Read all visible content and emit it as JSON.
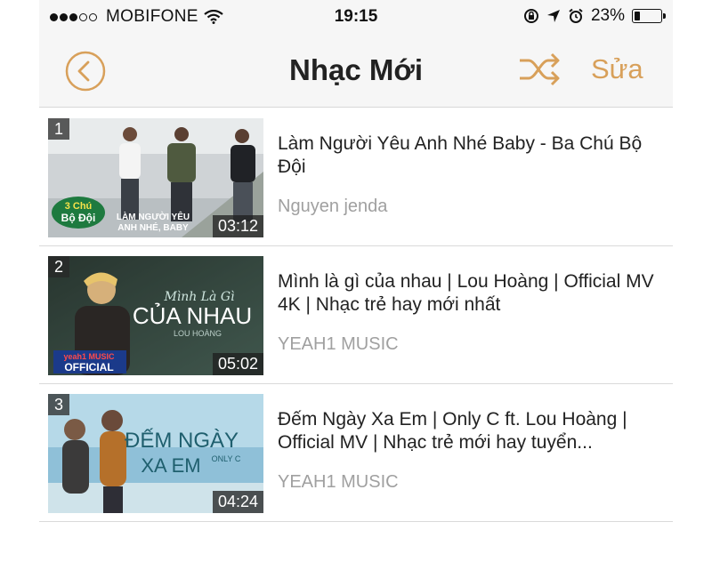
{
  "status_bar": {
    "carrier": "MOBIFONE",
    "time": "19:15",
    "battery_text": "23%",
    "battery_level": 0.23
  },
  "nav": {
    "title": "Nhạc Mới",
    "edit_label": "Sửa",
    "icon_names": [
      "back-circle-icon",
      "shuffle-icon"
    ],
    "accent_color": "#d8a05a"
  },
  "songs": [
    {
      "rank": "1",
      "title": "Làm Người Yêu Anh Nhé Baby - Ba Chú Bộ Đội",
      "channel": "Nguyen jenda",
      "duration": "03:12",
      "thumb_text_1": "3 Chú",
      "thumb_text_2": "Bộ Đội",
      "thumb_text_3": "LÀM NGƯỜI YÊU",
      "thumb_text_4": "ANH NHÉ, BABY"
    },
    {
      "rank": "2",
      "title": "Mình là gì của nhau | Lou Hoàng | Official MV 4K | Nhạc trẻ hay mới nhất",
      "channel": "YEAH1 MUSIC",
      "duration": "05:02",
      "thumb_text_1": "Mình Là Gì",
      "thumb_text_2": "CỦA NHAU",
      "thumb_text_3": "LOU HOÀNG",
      "thumb_text_4": "yeah1 MUSIC",
      "thumb_text_5": "OFFICIAL"
    },
    {
      "rank": "3",
      "title": "Đếm Ngày Xa Em | Only C ft. Lou Hoàng | Official MV | Nhạc trẻ mới hay tuyển...",
      "channel": "YEAH1 MUSIC",
      "duration": "04:24",
      "thumb_text_1": "ĐẾM NGÀY",
      "thumb_text_2": "XA EM",
      "thumb_text_3": "ONLY C"
    }
  ]
}
